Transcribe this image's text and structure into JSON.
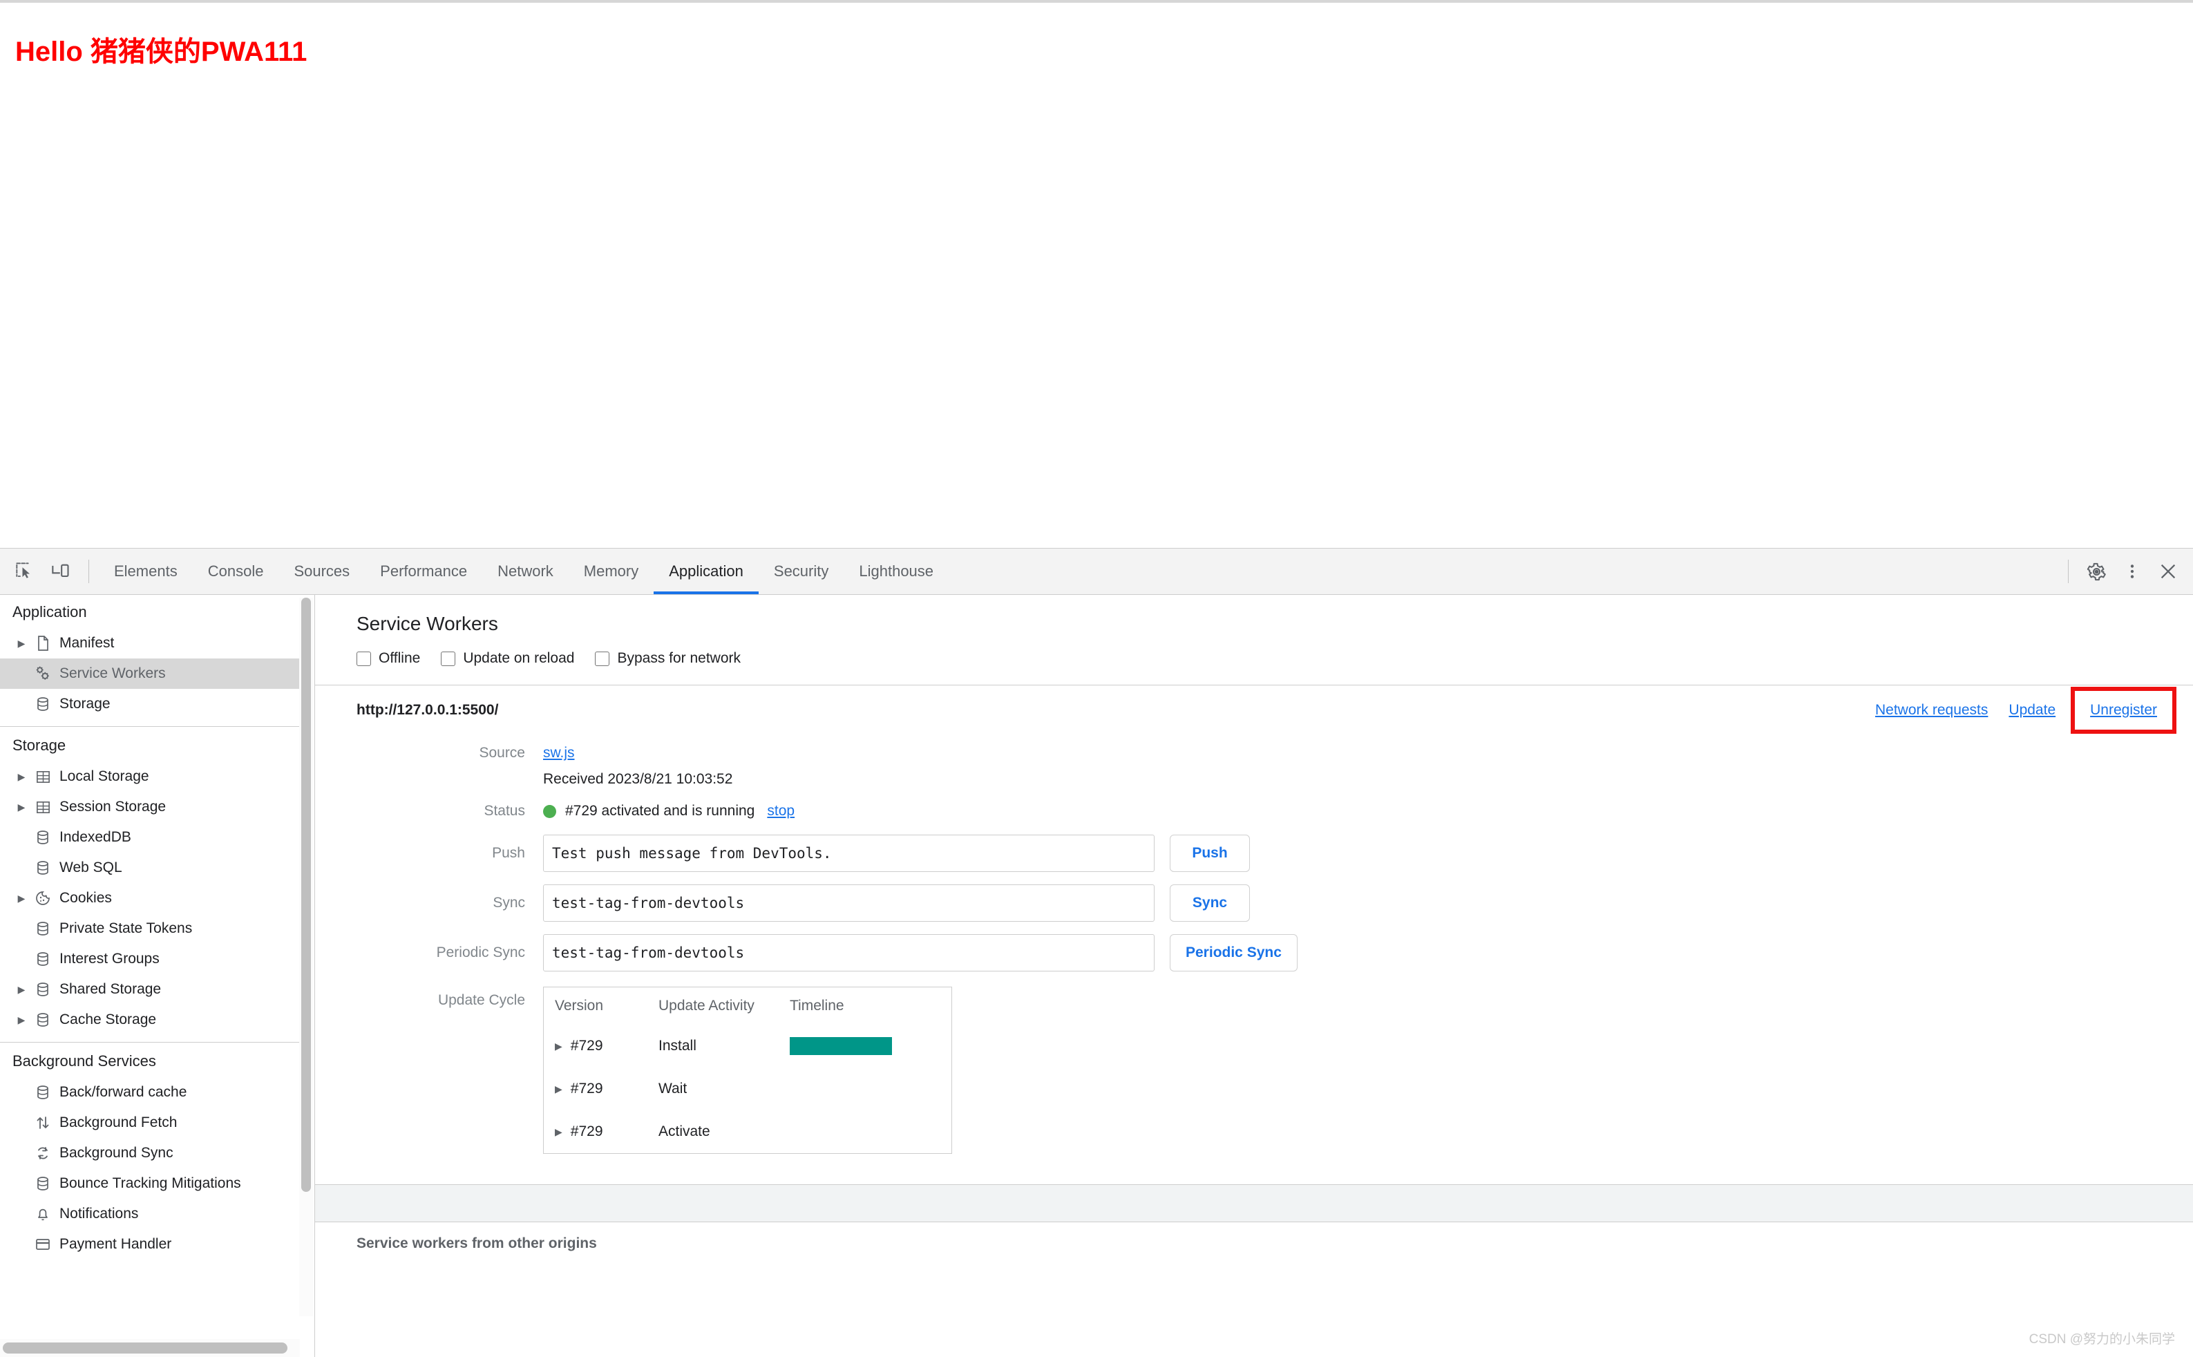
{
  "page": {
    "heading": "Hello 猪猪侠的PWA111",
    "heading_color": "#ff0000"
  },
  "devtools": {
    "toolbar": {
      "inspect_icon": "inspect-element-icon",
      "device_icon": "device-toolbar-icon",
      "tabs": [
        {
          "label": "Elements",
          "active": false
        },
        {
          "label": "Console",
          "active": false
        },
        {
          "label": "Sources",
          "active": false
        },
        {
          "label": "Performance",
          "active": false
        },
        {
          "label": "Network",
          "active": false
        },
        {
          "label": "Memory",
          "active": false
        },
        {
          "label": "Application",
          "active": true
        },
        {
          "label": "Security",
          "active": false
        },
        {
          "label": "Lighthouse",
          "active": false
        }
      ],
      "active_tab": "Application",
      "settings_icon": "gear-icon",
      "more_icon": "more-vertical-icon",
      "close_icon": "close-icon",
      "accent_color": "#1a73e8"
    },
    "sidebar": {
      "sections": [
        {
          "title": "Application",
          "items": [
            {
              "label": "Manifest",
              "icon": "document-icon",
              "expandable": true,
              "selected": false
            },
            {
              "label": "Service Workers",
              "icon": "gears-icon",
              "expandable": false,
              "selected": true
            },
            {
              "label": "Storage",
              "icon": "database-icon",
              "expandable": false,
              "selected": false
            }
          ]
        },
        {
          "title": "Storage",
          "items": [
            {
              "label": "Local Storage",
              "icon": "table-icon",
              "expandable": true,
              "selected": false
            },
            {
              "label": "Session Storage",
              "icon": "table-icon",
              "expandable": true,
              "selected": false
            },
            {
              "label": "IndexedDB",
              "icon": "database-icon",
              "expandable": false,
              "selected": false
            },
            {
              "label": "Web SQL",
              "icon": "database-icon",
              "expandable": false,
              "selected": false
            },
            {
              "label": "Cookies",
              "icon": "cookie-icon",
              "expandable": true,
              "selected": false
            },
            {
              "label": "Private State Tokens",
              "icon": "database-icon",
              "expandable": false,
              "selected": false
            },
            {
              "label": "Interest Groups",
              "icon": "database-icon",
              "expandable": false,
              "selected": false
            },
            {
              "label": "Shared Storage",
              "icon": "database-icon",
              "expandable": true,
              "selected": false
            },
            {
              "label": "Cache Storage",
              "icon": "database-icon",
              "expandable": true,
              "selected": false
            }
          ]
        },
        {
          "title": "Background Services",
          "items": [
            {
              "label": "Back/forward cache",
              "icon": "database-icon",
              "expandable": false,
              "selected": false
            },
            {
              "label": "Background Fetch",
              "icon": "arrows-updown-icon",
              "expandable": false,
              "selected": false
            },
            {
              "label": "Background Sync",
              "icon": "sync-icon",
              "expandable": false,
              "selected": false
            },
            {
              "label": "Bounce Tracking Mitigations",
              "icon": "database-icon",
              "expandable": false,
              "selected": false
            },
            {
              "label": "Notifications",
              "icon": "bell-icon",
              "expandable": false,
              "selected": false
            },
            {
              "label": "Payment Handler",
              "icon": "card-icon",
              "expandable": false,
              "selected": false
            }
          ]
        }
      ]
    },
    "service_workers": {
      "title": "Service Workers",
      "toggles": [
        {
          "label": "Offline",
          "checked": false
        },
        {
          "label": "Update on reload",
          "checked": false
        },
        {
          "label": "Bypass for network",
          "checked": false
        }
      ],
      "origin": "http://127.0.0.1:5500/",
      "actions": {
        "network_requests": "Network requests",
        "update": "Update",
        "unregister": "Unregister",
        "highlight_color": "#ee1111"
      },
      "fields": {
        "source_label": "Source",
        "source_file": "sw.js",
        "received_label": "Received 2023/8/21 10:03:52",
        "status_label": "Status",
        "status_text": "#729 activated and is running",
        "status_dot_color": "#4caf50",
        "stop_link": "stop",
        "push_label": "Push",
        "push_value": "Test push message from DevTools.",
        "push_button": "Push",
        "sync_label": "Sync",
        "sync_value": "test-tag-from-devtools",
        "sync_button": "Sync",
        "periodic_sync_label": "Periodic Sync",
        "periodic_sync_value": "test-tag-from-devtools",
        "periodic_sync_button": "Periodic Sync"
      },
      "update_cycle": {
        "label": "Update Cycle",
        "columns": [
          "Version",
          "Update Activity",
          "Timeline"
        ],
        "bar_color": "#009688",
        "rows": [
          {
            "version": "#729",
            "activity": "Install",
            "has_bar": true
          },
          {
            "version": "#729",
            "activity": "Wait",
            "has_bar": false
          },
          {
            "version": "#729",
            "activity": "Activate",
            "has_bar": false
          }
        ]
      },
      "other_origins_title": "Service workers from other origins"
    }
  },
  "watermark": "CSDN @努力的小朱同学"
}
